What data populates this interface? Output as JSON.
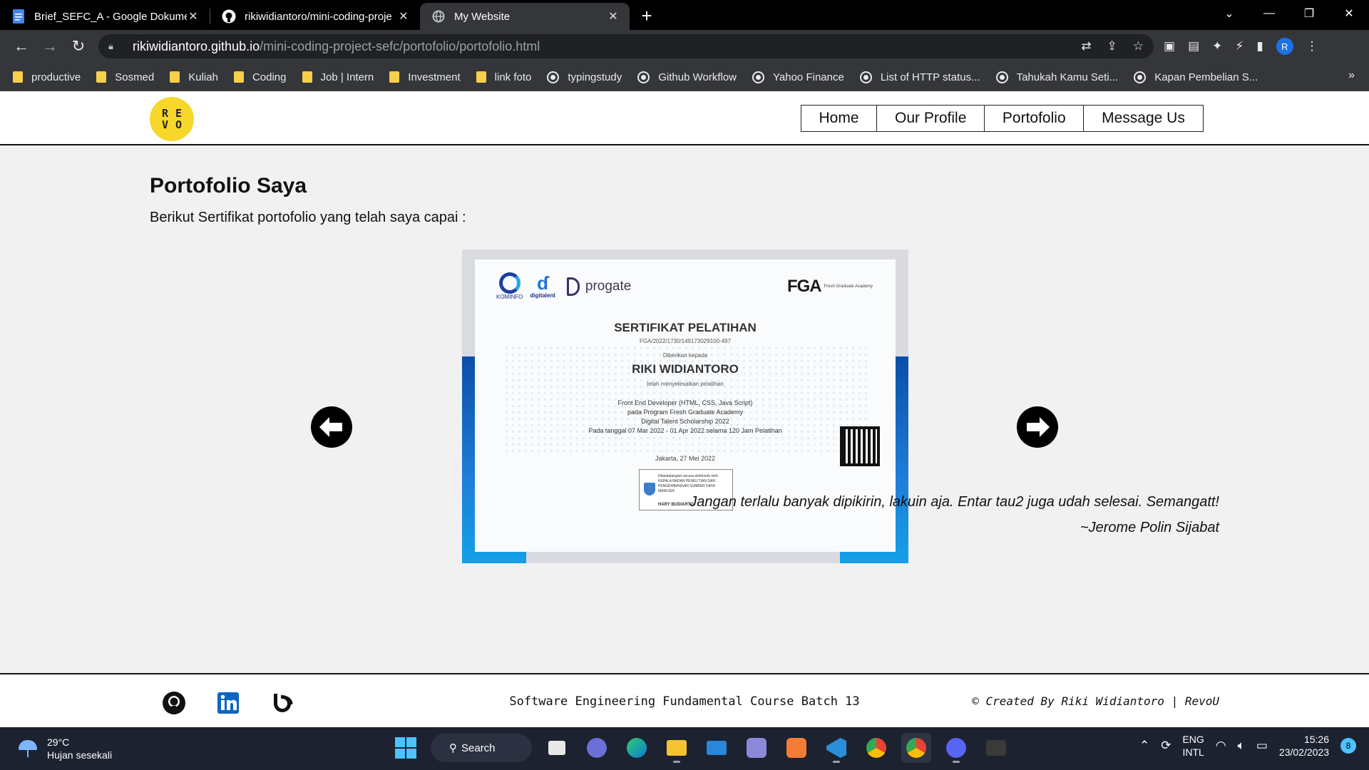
{
  "browser": {
    "tabs": [
      {
        "title": "Brief_SEFC_A - Google Dokumen",
        "icon": "google-docs-icon",
        "active": false
      },
      {
        "title": "rikiwidiantoro/mini-coding-proje",
        "icon": "github-icon",
        "active": false
      },
      {
        "title": "My Website",
        "icon": "globe-icon",
        "active": true
      }
    ],
    "new_tab": "+",
    "url_host": "rikiwidiantoro.github.io",
    "url_path": "/mini-coding-project-sefc/portofolio/portofolio.html",
    "profile_initial": "R",
    "bookmarks": [
      {
        "label": "productive",
        "type": "folder"
      },
      {
        "label": "Sosmed",
        "type": "folder"
      },
      {
        "label": "Kuliah",
        "type": "folder"
      },
      {
        "label": "Coding",
        "type": "folder"
      },
      {
        "label": "Job | Intern",
        "type": "folder"
      },
      {
        "label": "Investment",
        "type": "folder"
      },
      {
        "label": "link foto",
        "type": "folder"
      },
      {
        "label": "typingstudy",
        "type": "link"
      },
      {
        "label": "Github Workflow",
        "type": "link"
      },
      {
        "label": "Yahoo Finance",
        "type": "link"
      },
      {
        "label": "List of HTTP status...",
        "type": "link"
      },
      {
        "label": "Tahukah Kamu Seti...",
        "type": "link"
      },
      {
        "label": "Kapan Pembelian S...",
        "type": "link"
      }
    ],
    "bookmarks_more": "»"
  },
  "site": {
    "logo_letters": [
      "R",
      "E",
      "V",
      "O"
    ],
    "nav": [
      "Home",
      "Our Profile",
      "Portofolio",
      "Message Us"
    ],
    "title": "Portofolio Saya",
    "subtitle": "Berikut Sertifikat portofolio yang telah saya capai :",
    "certificate": {
      "kominfo": "KOMINFO",
      "digitalent": "digitalent",
      "progate": "progate",
      "fga": "FGA",
      "fga_sub": "Fresh Graduate Academy",
      "heading": "SERTIFIKAT PELATIHAN",
      "number": "FGA/2022/1730/149173029100-497",
      "given_to": "Diberikan kepada",
      "name": "RIKI WIDIANTORO",
      "completed": "telah menyelesaikan pelatihan",
      "line1": "Front End Developer (HTML, CSS, Java Script)",
      "line2": "pada Program Fresh Graduate Academy",
      "line3": "Digital Talent Scholarship 2022",
      "line4": "Pada tanggal 07 Mar 2022 - 01 Apr 2022 selama 120 Jam Pelatihan",
      "place_date": "Jakarta, 27 Mei 2022",
      "signed_note": "Ditandatangani secara elektronik oleh: KEPALA BADAN PENELITIAN DAN PENGEMBANGAN SUMBER DAYA MANUSIA",
      "signer": "HARY BUDIARTO"
    },
    "quote": "Jangan terlalu banyak dipikirin, lakuin aja. Entar tau2 juga udah selesai. Semangatt!",
    "quote_author": "~Jerome Polin Sijabat",
    "footer_center": "Software Engineering Fundamental Course Batch 13",
    "footer_right": "© Created By Riki Widiantoro | RevoU"
  },
  "taskbar": {
    "temperature": "29°C",
    "weather": "Hujan sesekali",
    "search": "Search",
    "lang1": "ENG",
    "lang2": "INTL",
    "time": "15:26",
    "date": "23/02/2023",
    "notifications": "8"
  },
  "colors": {
    "logo_yellow": "#f6d72a",
    "chrome_dark": "#35363a",
    "taskbar": "#1c2230"
  }
}
